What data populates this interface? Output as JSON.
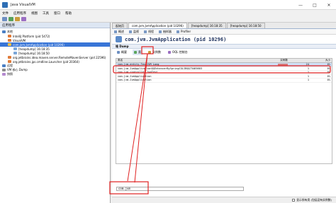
{
  "window": {
    "title": "Java VisualVM",
    "controls": [
      "—",
      "□",
      "✕"
    ]
  },
  "menu": [
    "文件",
    "应用程序",
    "视图",
    "工具",
    "窗口",
    "帮助"
  ],
  "left_panel": {
    "header": "应用程序",
    "tree": [
      {
        "label": "本地",
        "level": 0
      },
      {
        "label": "IntelliJ Platform (pid 5472)",
        "level": 1
      },
      {
        "label": "VisualVM",
        "level": 1
      },
      {
        "label": "com.jvm.JvmApplication (pid 10296)",
        "level": 1,
        "selected": true
      },
      {
        "label": "[heapdump] 16:18:35",
        "level": 2
      },
      {
        "label": "[heapdump] 16:18:50",
        "level": 2
      },
      {
        "label": "org.jetbrains.idea.maven.server.RemoteMavenServer (pid 22596)",
        "level": 1
      },
      {
        "label": "org.jetbrains.jps.cmdline.Launcher (pid 20364)",
        "level": 1
      },
      {
        "label": "远程",
        "level": 0
      },
      {
        "label": "VM 核心 Dump",
        "level": 0
      },
      {
        "label": "快照",
        "level": 0
      }
    ]
  },
  "tabs": [
    {
      "label": "起始页",
      "active": false
    },
    {
      "label": "com.jvm.JvmApplication (pid 10296)",
      "active": true
    },
    {
      "label": "[heapdump] 16:18:35",
      "active": false
    },
    {
      "label": "[heapdump] 16:18:50",
      "active": false
    }
  ],
  "subtabs": [
    "概述",
    "监视",
    "线程",
    "抽样器",
    "Profiler"
  ],
  "heading": "com.jvm.JvmApplication (pid 10296)",
  "section": "堆 Dump",
  "heap_buttons": [
    "概要",
    "类",
    "实例数",
    "OQL 控制台"
  ],
  "table": {
    "columns": [
      "类名",
      "实例数",
      "大小"
    ],
    "rows": [
      {
        "name": "com.jvm.entity.TestJVM_Long",
        "count": "24",
        "pct": "0%",
        "size": "0"
      },
      {
        "name": "com.jvm.JvmApplication$$EnhancerBySpringCGLIB$$73465603",
        "count": "1",
        "pct": "0%",
        "size": "0"
      },
      {
        "name": "com.jvm.controller.JvmTest",
        "count": "1",
        "pct": "0%",
        "size": "0"
      },
      {
        "name": "com.jvm.JvmApplication",
        "count": "1",
        "pct": "0%",
        "size": "0"
      },
      {
        "name": "com.jvm.JvmApplication",
        "count": "1",
        "pct": "0%",
        "size": "0"
      }
    ]
  },
  "filter": {
    "value": "com.jvm"
  },
  "status": {
    "label": "显示所有类 (包括没有实例数)"
  },
  "colors": {
    "annotation_red": "#e02020",
    "selection": "#3875d7"
  }
}
